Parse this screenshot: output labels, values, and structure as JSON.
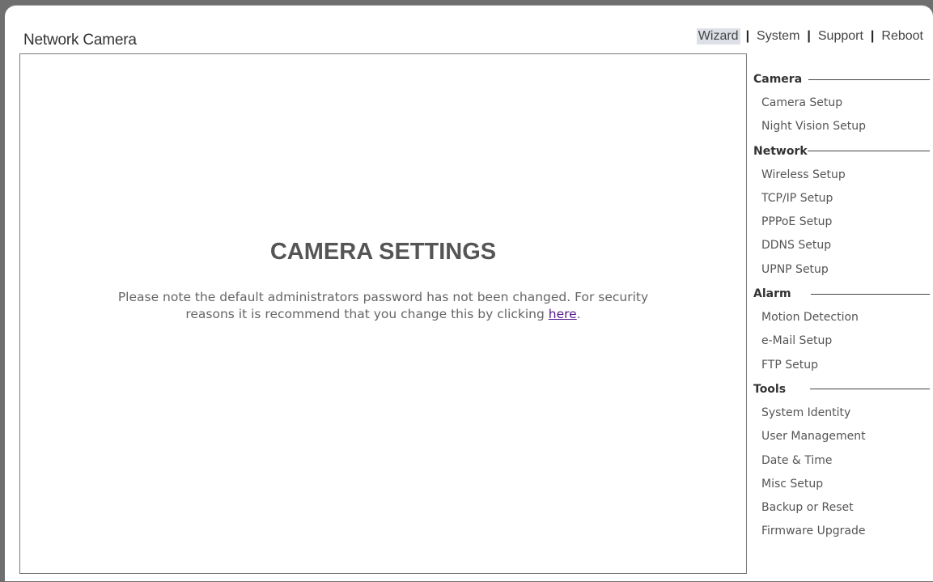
{
  "header": {
    "title": "Network Camera",
    "nav": [
      {
        "label": "Wizard",
        "active": true
      },
      {
        "label": "System",
        "active": false
      },
      {
        "label": "Support",
        "active": false
      },
      {
        "label": "Reboot",
        "active": false
      }
    ],
    "separator": "|"
  },
  "main": {
    "title": "CAMERA SETTINGS",
    "notice_line1": "Please note the default administrators password has not been changed. For security",
    "notice_line2_prefix": "reasons it is recommend that you change this by clicking ",
    "notice_link": "here",
    "notice_suffix": "."
  },
  "sidebar": {
    "sections": [
      {
        "header": "Camera",
        "items": [
          "Camera Setup",
          "Night Vision Setup"
        ]
      },
      {
        "header": "Network",
        "items": [
          "Wireless Setup",
          "TCP/IP Setup",
          "PPPoE Setup",
          "DDNS Setup",
          "UPNP Setup"
        ]
      },
      {
        "header": "Alarm",
        "items": [
          "Motion Detection",
          "e-Mail Setup",
          "FTP Setup"
        ]
      },
      {
        "header": "Tools",
        "items": [
          "System Identity",
          "User Management",
          "Date & Time",
          "Misc Setup",
          "Backup or Reset",
          "Firmware Upgrade"
        ]
      }
    ]
  },
  "colors": {
    "link_visited": "#551a8b",
    "active_nav_bg": "#dde0e6",
    "title_gray": "#555555"
  }
}
